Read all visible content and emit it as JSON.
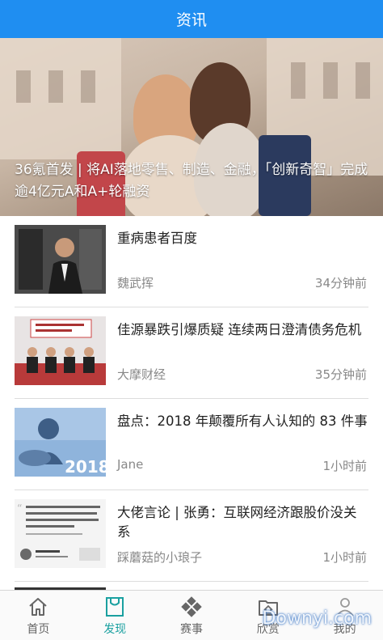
{
  "header": {
    "title": "资讯"
  },
  "hero": {
    "caption": "36氪首发 | 将AI落地零售、制造、金融，「创新奇智」完成逾4亿元A和A+轮融资"
  },
  "news": [
    {
      "title": "重病患者百度",
      "author": "魏武挥",
      "time": "34分钟前"
    },
    {
      "title": "佳源暴跌引爆质疑 连续两日澄清债务危机",
      "author": "大摩财经",
      "time": "35分钟前"
    },
    {
      "title": "盘点：2018 年颠覆所有人认知的 83 件事",
      "author": "Jane",
      "time": "1小时前",
      "thumb_text": "2018"
    },
    {
      "title": "大佬言论 | 张勇：互联网经济跟股价没关系",
      "author": "踩蘑菇的小琅子",
      "time": "1小时前"
    }
  ],
  "tabbar": {
    "items": [
      {
        "label": "首页",
        "icon": "home-icon"
      },
      {
        "label": "发现",
        "icon": "bag-icon",
        "active": true
      },
      {
        "label": "赛事",
        "icon": "diamond-grid-icon"
      },
      {
        "label": "欣赏",
        "icon": "folder-home-icon"
      },
      {
        "label": "我的",
        "icon": "person-icon"
      }
    ]
  },
  "watermark": "Downyi.com",
  "colors": {
    "accent": "#1f8ef1",
    "active_tab": "#1aa0a0"
  }
}
